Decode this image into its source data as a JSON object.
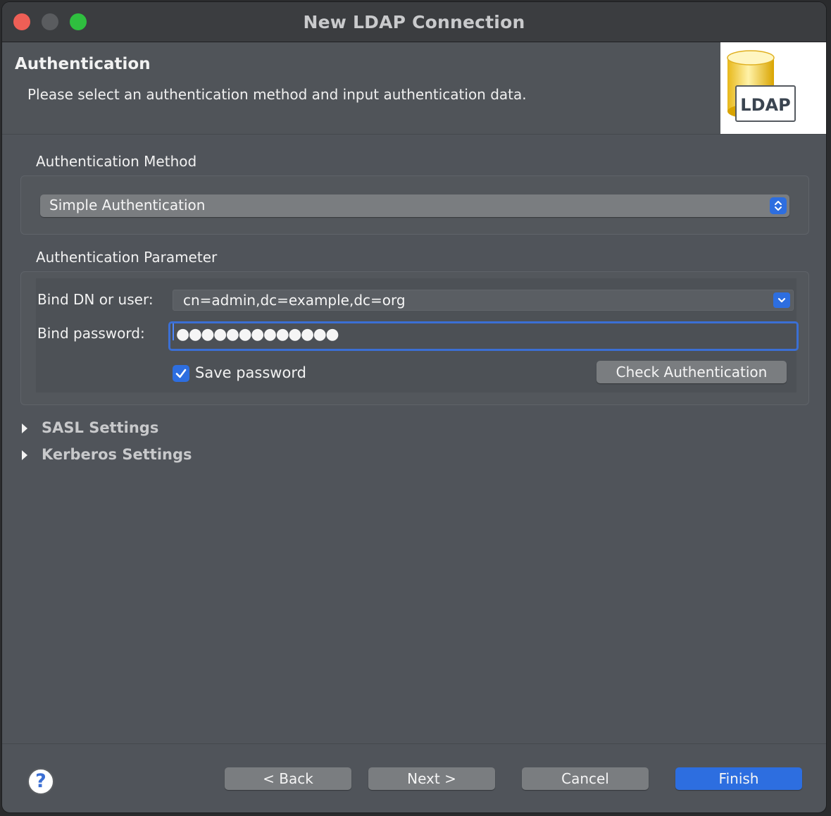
{
  "window": {
    "title": "New LDAP Connection"
  },
  "header": {
    "title": "Authentication",
    "description": "Please select an authentication method and input authentication data.",
    "logo_text": "LDAP"
  },
  "auth_method": {
    "section_label": "Authentication Method",
    "selected": "Simple Authentication"
  },
  "auth_param": {
    "section_label": "Authentication Parameter",
    "bind_dn_label": "Bind DN or user:",
    "bind_dn_value": "cn=admin,dc=example,dc=org",
    "bind_password_label": "Bind password:",
    "bind_password_value": "●●●●●●●●●●●●●",
    "save_password_label": "Save password",
    "save_password_checked": true,
    "check_auth_label": "Check Authentication"
  },
  "expanders": {
    "sasl_label": "SASL Settings",
    "kerberos_label": "Kerberos Settings"
  },
  "footer": {
    "help_label": "?",
    "back_label": "< Back",
    "next_label": "Next >",
    "cancel_label": "Cancel",
    "finish_label": "Finish"
  },
  "colors": {
    "accent": "#2d6ee0",
    "window_bg": "#50545a",
    "close": "#ee5f56",
    "maximize": "#2fbf3f"
  }
}
